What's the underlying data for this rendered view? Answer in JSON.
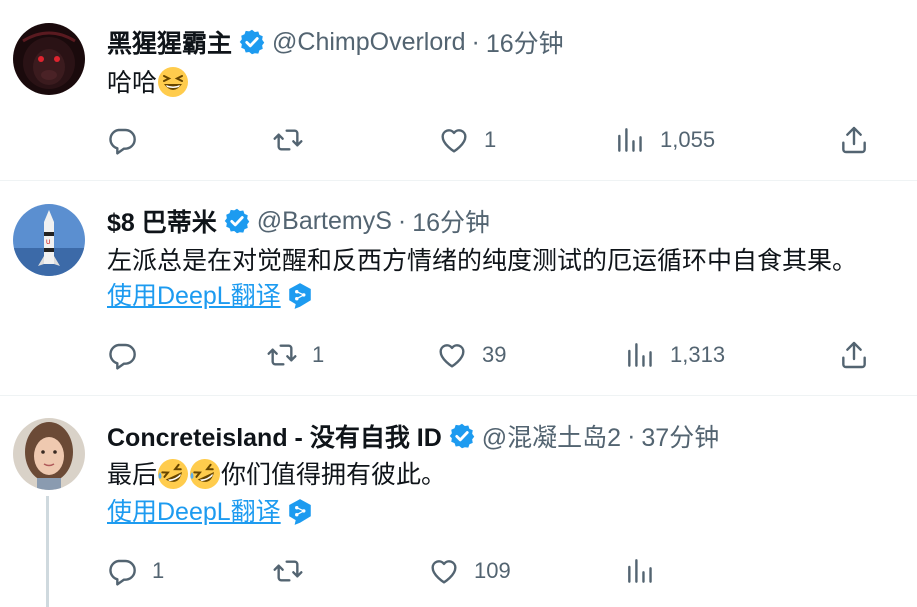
{
  "colors": {
    "verified": "#1d9bf0",
    "link": "#1d9bf0",
    "secondary_text": "#536471",
    "divider": "#eff3f4",
    "thread_line": "#cfd9de"
  },
  "tweets": [
    {
      "name": "黑猩猩霸主",
      "handle": "@ChimpOverlord",
      "dot": "·",
      "time": "16分钟",
      "text_before_emoji": "哈哈",
      "emoji": "grinning-squinting-face",
      "actions": {
        "reply_count": "",
        "retweet_count": "",
        "like_count": "1",
        "views_count": "1,055"
      }
    },
    {
      "name": "$8 巴蒂米",
      "handle": "@BartemyS",
      "dot": "·",
      "time": "16分钟",
      "text": "左派总是在对觉醒和反西方情绪的纯度测试的厄运循环中自食其果。",
      "translate_label": "使用DeepL翻译",
      "actions": {
        "reply_count": "",
        "retweet_count": "1",
        "like_count": "39",
        "views_count": "1,313"
      }
    },
    {
      "name": "Concreteisland - 没有自我 ID",
      "handle": "@混凝土岛2",
      "dot": "·",
      "time": "37分钟",
      "text_before_emoji": "最后",
      "emoji": "rolling-on-floor-laughing-face",
      "text_after_emoji": "你们值得拥有彼此。",
      "translate_label": "使用DeepL翻译",
      "actions": {
        "reply_count": "1",
        "retweet_count": "",
        "like_count": "109",
        "views_count": ""
      }
    }
  ]
}
